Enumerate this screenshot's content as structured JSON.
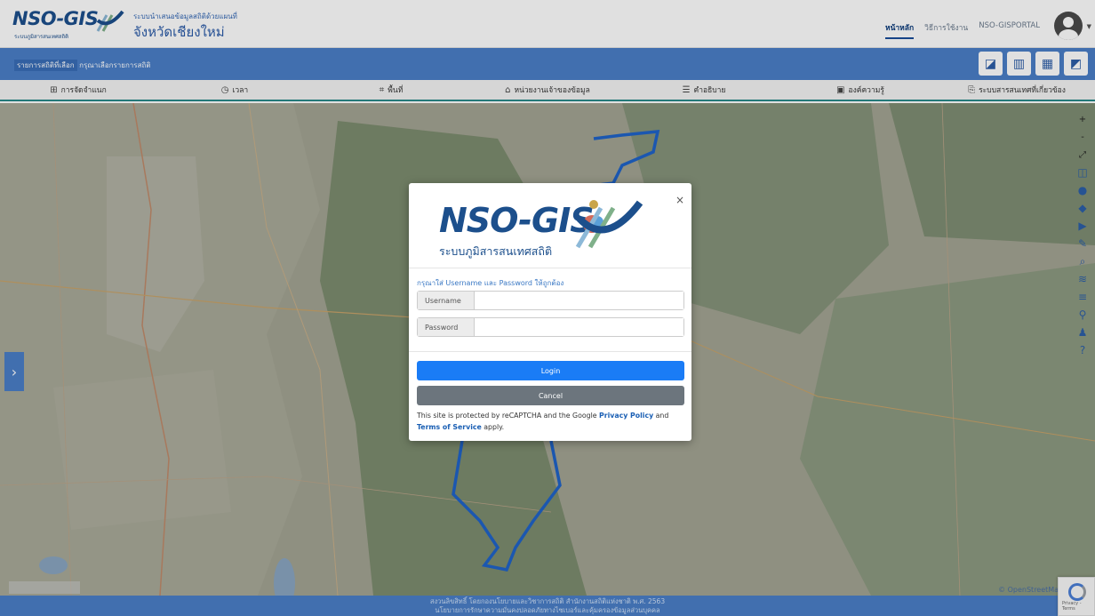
{
  "header": {
    "logo_text": "NSO-GIS",
    "logo_sub": "ระบบภูมิสารสนเทศสถิติ",
    "brand_line1": "ระบบนำเสนอข้อมูลสถิติด้วยแผนที่",
    "brand_line2": "จังหวัดเชียงใหม่",
    "links": [
      "หน้าหลัก",
      "วิธีการใช้งาน",
      "NSO-GISPORTAL"
    ]
  },
  "selection_bar": {
    "label": "รายการสถิติที่เลือก",
    "hint": "กรุณาเลือกรายการสถิติ"
  },
  "menu": {
    "items": [
      {
        "icon": "sitemap-icon",
        "label": "การจัดจำแนก"
      },
      {
        "icon": "clock-icon",
        "label": "เวลา"
      },
      {
        "icon": "area-icon",
        "label": "พื้นที่"
      },
      {
        "icon": "bank-icon",
        "label": "หน่วยงานเจ้าของข้อมูล"
      },
      {
        "icon": "book-icon",
        "label": "คำอธิบาย"
      },
      {
        "icon": "knowledge-icon",
        "label": "องค์ความรู้"
      },
      {
        "icon": "link-icon",
        "label": "ระบบสารสนเทศที่เกี่ยวข้อง"
      }
    ]
  },
  "map": {
    "attribution": "© OpenStreetMap co"
  },
  "footer": {
    "line1": "สงวนลิขสิทธิ์ โดยกองนโยบายและวิชาการสถิติ สำนักงานสถิติแห่งชาติ พ.ศ. 2563",
    "line2": "นโยบายการรักษาความมั่นคงปลอดภัยทางไซเบอร์และคุ้มครองข้อมูลส่วนบุคคล"
  },
  "recaptcha": {
    "text": "Privacy - Terms"
  },
  "login_modal": {
    "close": "×",
    "logo_text": "NSO-GIS",
    "logo_sub": "ระบบภูมิสารสนเทศสถิติ",
    "message": "กรุณาใส่ Username และ Password ให้ถูกต้อง",
    "username_label": "Username",
    "username_value": "",
    "password_label": "Password",
    "password_value": "",
    "login_label": "Login",
    "cancel_label": "Cancel",
    "legal_prefix": "This site is protected by reCAPTCHA and the Google",
    "privacy_label": "Privacy Policy",
    "legal_and": "and",
    "terms_label": "Terms of Service",
    "legal_suffix": "apply."
  },
  "colors": {
    "primary": "#4a7fc8",
    "login": "#1a7cf6",
    "cancel": "#6c757d",
    "logo": "#1c4f8c"
  }
}
